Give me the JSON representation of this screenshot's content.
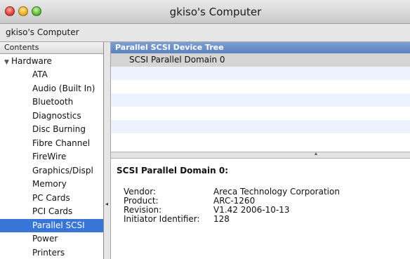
{
  "window": {
    "title": "gkiso's Computer"
  },
  "toolbar": {
    "breadcrumb": "gkiso's Computer"
  },
  "sidebar": {
    "header": "Contents",
    "root": "Hardware",
    "items": [
      {
        "label": "ATA"
      },
      {
        "label": "Audio (Built In)"
      },
      {
        "label": "Bluetooth"
      },
      {
        "label": "Diagnostics"
      },
      {
        "label": "Disc Burning"
      },
      {
        "label": "Fibre Channel"
      },
      {
        "label": "FireWire"
      },
      {
        "label": "Graphics/Displ"
      },
      {
        "label": "Memory"
      },
      {
        "label": "PC Cards"
      },
      {
        "label": "PCI Cards"
      },
      {
        "label": "Parallel SCSI"
      },
      {
        "label": "Power"
      },
      {
        "label": "Printers"
      }
    ],
    "selected": "Parallel SCSI"
  },
  "tree": {
    "header": "Parallel SCSI Device Tree",
    "rows": [
      {
        "label": "SCSI Parallel Domain 0"
      }
    ]
  },
  "detail": {
    "title": "SCSI Parallel Domain 0:",
    "fields": [
      {
        "key": "Vendor:",
        "value": "Areca Technology Corporation"
      },
      {
        "key": "Product:",
        "value": "ARC-1260"
      },
      {
        "key": "Revision:",
        "value": "V1.42 2006-10-13"
      },
      {
        "key": "Initiator Identifier:",
        "value": "128"
      }
    ]
  },
  "icons": {
    "traffic_lights": [
      "close-button-icon",
      "minimize-button-icon",
      "zoom-button-icon"
    ],
    "disclosure": "disclosure-triangle-down-icon"
  },
  "colors": {
    "selection": "#3875d7",
    "pane_header": "#6b8fc9"
  }
}
